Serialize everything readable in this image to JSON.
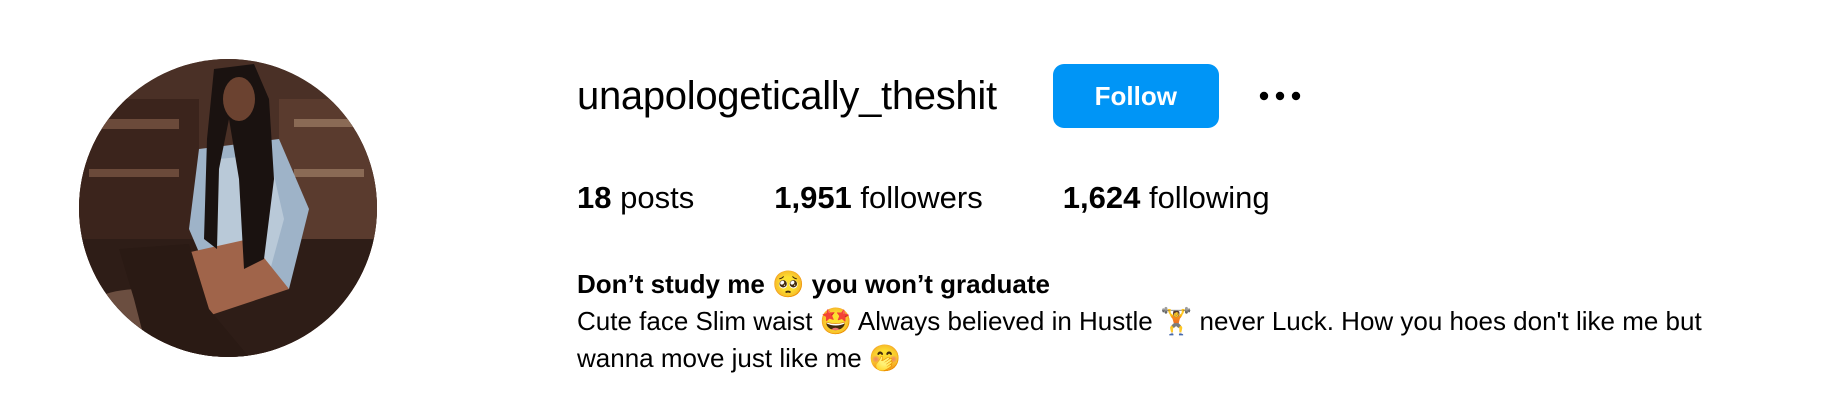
{
  "profile": {
    "username": "unapologetically_theshit",
    "follow_label": "Follow",
    "more_icon": "more-options-icon",
    "stats": {
      "posts_count": "18",
      "posts_label": "posts",
      "followers_count": "1,951",
      "followers_label": "followers",
      "following_count": "1,624",
      "following_label": "following"
    },
    "bio": {
      "name_part1": "Don’t study me ",
      "name_emoji": "🥺",
      "name_part2": " you won’t graduate",
      "line_part1": "Cute face Slim waist ",
      "emoji1": "🤩",
      "line_part2": " Always believed in Hustle ",
      "emoji2": "🏋",
      "line_part3": " never Luck. How you hoes don't like me but wanna move just like me ",
      "emoji3": "🤭"
    }
  },
  "colors": {
    "follow_button": "#0095f6",
    "text": "#000000",
    "background": "#ffffff"
  }
}
